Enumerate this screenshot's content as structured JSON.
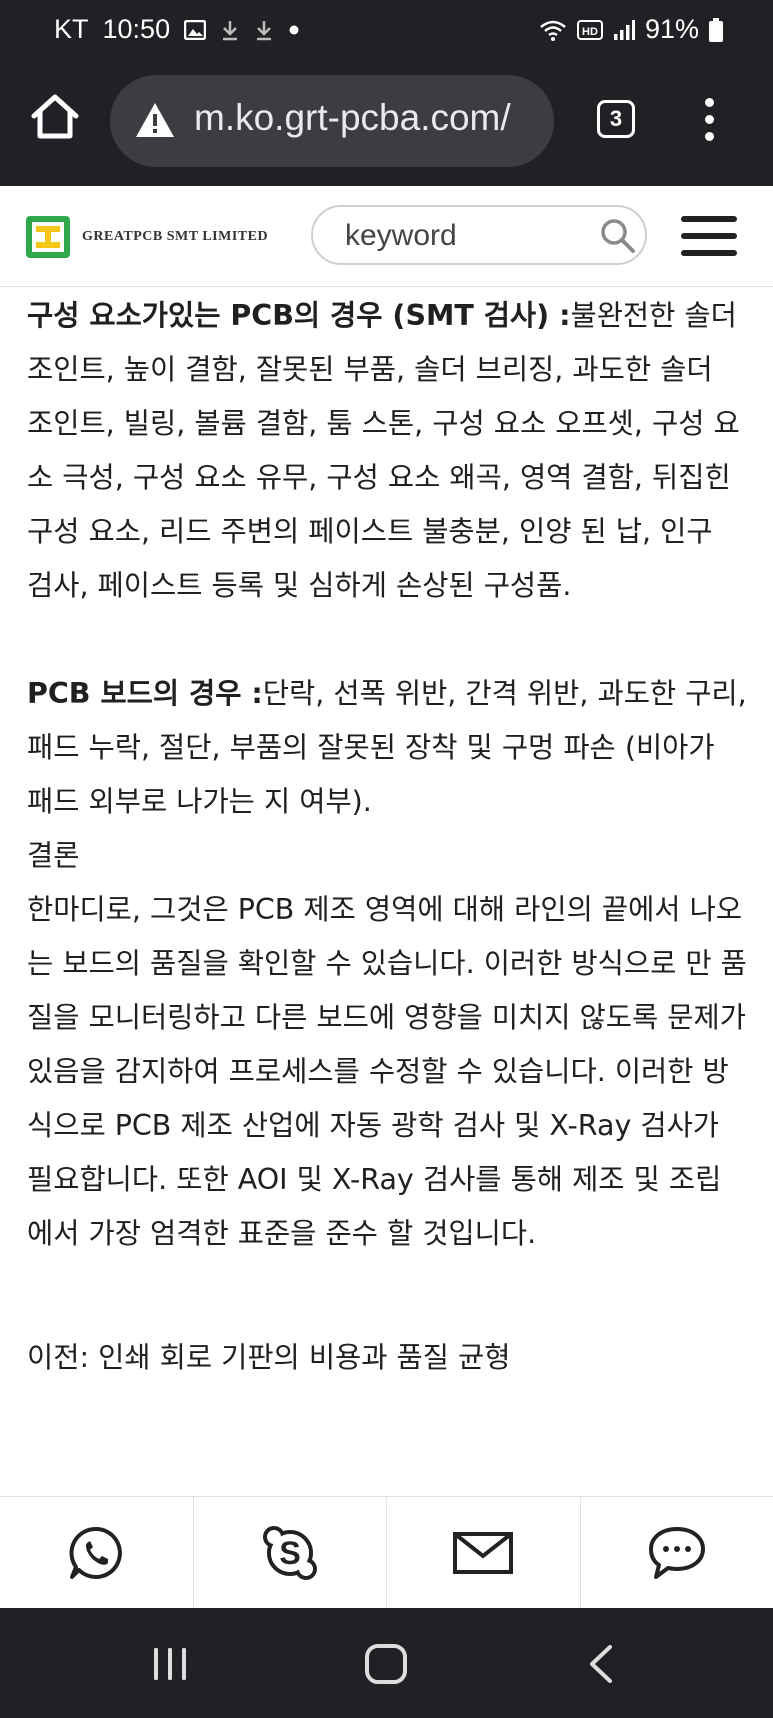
{
  "status_bar": {
    "carrier": "KT",
    "time": "10:50",
    "battery": "91%",
    "icons": [
      "image-icon",
      "download-icon",
      "download-icon",
      "dot-icon",
      "wifi-icon",
      "hd-icon",
      "signal-icon",
      "battery-icon"
    ]
  },
  "browser": {
    "url": "m.ko.grt-pcba.com/",
    "tab_count": "3"
  },
  "site_header": {
    "brand": "GREATPCB SMT LIMITED",
    "search_placeholder": "keyword"
  },
  "article": {
    "p1_bold": "구성 요소가있는 PCB의 경우 (SMT 검사) :",
    "p1_text": "불완전한 솔더 조인트, 높이 결함, 잘못된 부품, 솔더 브리징, 과도한 솔더 조인트, 빌링, 볼륨 결함, 툼 스톤, 구성 요소 오프셋, 구성 요소 극성, 구성 요소 유무, 구성 요소 왜곡, 영역 결함, 뒤집힌 구성 요소, 리드 주변의 페이스트 불충분, 인양 된 납, 인구 검사, 페이스트 등록 및 심하게 손상된 구성품.",
    "p2_bold": "PCB 보드의 경우 :",
    "p2_text": "단락, 선폭 위반, 간격 위반, 과도한 구리, 패드 누락, 절단, 부품의 잘못된 장착 및 구멍 파손 (비아가 패드 외부로 나가는 지 여부).",
    "conclusion_heading": "결론",
    "conclusion_text": "한마디로, 그것은 PCB 제조 영역에 대해 라인의 끝에서 나오는 보드의 품질을 확인할 수 있습니다. 이러한 방식으로 만 품질을 모니터링하고 다른 보드에 영향을 미치지 않도록 문제가 있음을 감지하여 프로세스를 수정할 수 있습니다. 이러한 방식으로 PCB 제조 산업에 자동 광학 검사 및 X-Ray 검사가 필요합니다. 또한 AOI 및 X-Ray 검사를 통해 제조 및 조립에서 가장 엄격한 표준을 준수 할 것입니다.",
    "prev_link": "이전: 인쇄 회로 기판의 비용과 품질 균형"
  },
  "contact_bar": {
    "items": [
      "whatsapp-icon",
      "skype-icon",
      "mail-icon",
      "chat-icon"
    ]
  },
  "nav_bar": {
    "items": [
      "recents-icon",
      "home-icon",
      "back-icon"
    ]
  }
}
